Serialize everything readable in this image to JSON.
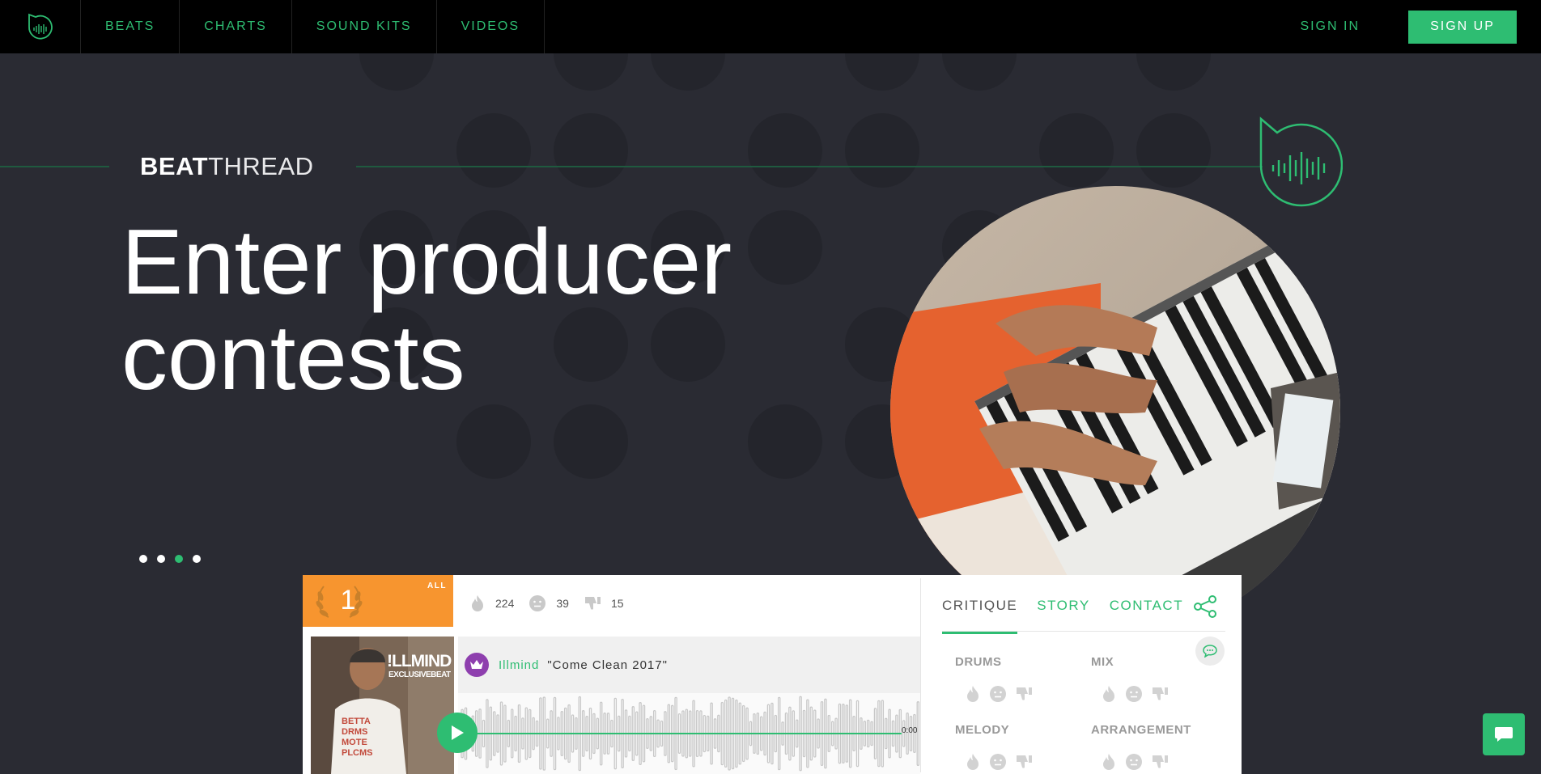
{
  "nav": {
    "logo": "beatthread-logo-icon",
    "items": [
      {
        "label": "BEATS"
      },
      {
        "label": "CHARTS"
      },
      {
        "label": "SOUND KITS"
      },
      {
        "label": "VIDEOS"
      }
    ],
    "sign_in": "SIGN IN",
    "sign_up": "SIGN UP"
  },
  "hero": {
    "brand_bold": "BEAT",
    "brand_light": "THREAD",
    "headline_line1": "Enter producer",
    "headline_line2": "contests",
    "pager": {
      "count": 4,
      "active_index": 2
    }
  },
  "card": {
    "rank": "1",
    "rank_scope": "ALL",
    "stats": {
      "fire": "224",
      "neutral": "39",
      "dislike": "15"
    },
    "cover_text_line1": "!LLMIND",
    "cover_text_line2": "EXCLUSIVEBEAT",
    "producer": "Illmind",
    "title": "\"Come Clean 2017\"",
    "time": "0:00",
    "tabs": [
      {
        "label": "CRITIQUE",
        "active": true
      },
      {
        "label": "STORY",
        "active": false
      },
      {
        "label": "CONTACT",
        "active": false
      }
    ],
    "critique": [
      "DRUMS",
      "MIX",
      "MELODY",
      "ARRANGEMENT"
    ]
  },
  "colors": {
    "accent": "#2ebd72",
    "rank": "#f7952f",
    "hero_bg": "#2a2b33",
    "nav_bg": "#000000"
  }
}
